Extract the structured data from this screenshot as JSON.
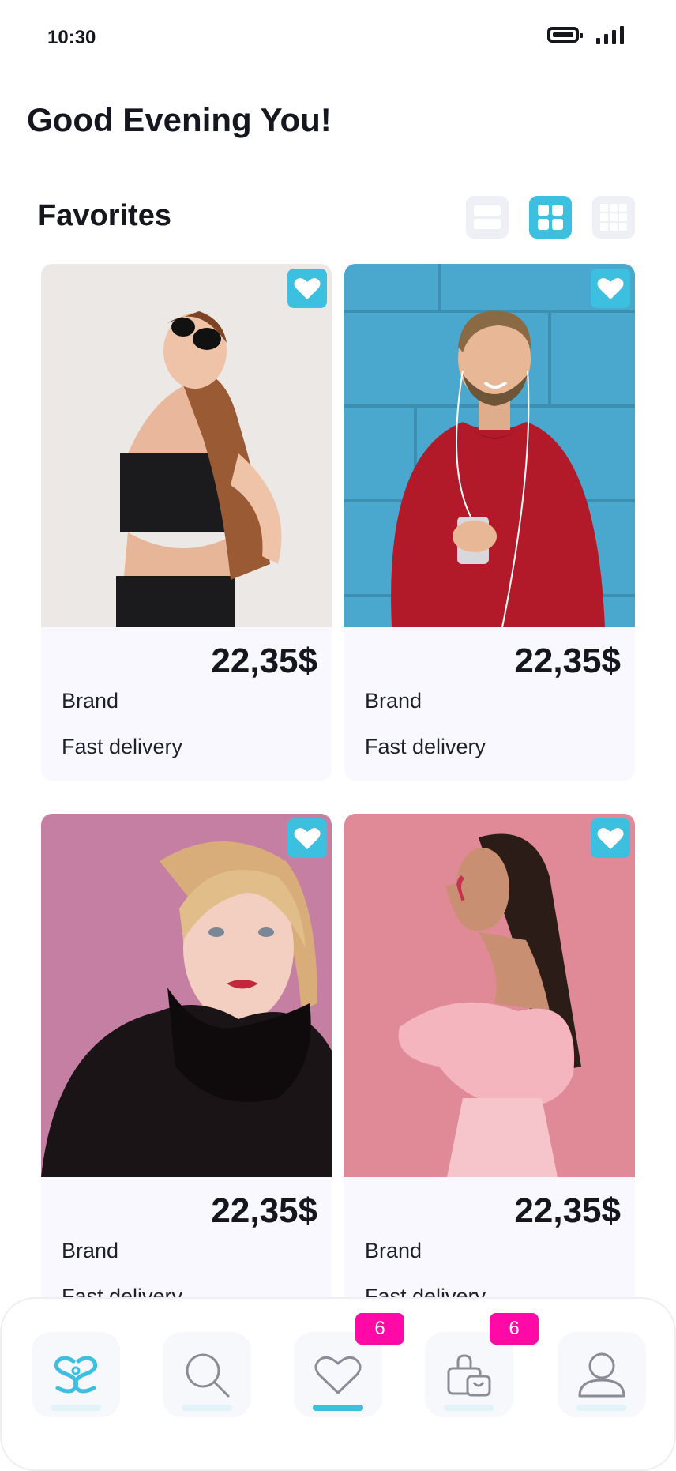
{
  "status_bar": {
    "time": "10:30"
  },
  "header": {
    "greeting": "Good Evening You!"
  },
  "section": {
    "title": "Favorites"
  },
  "products": [
    {
      "price": "22,35$",
      "brand": "Brand",
      "delivery": "Fast delivery",
      "image": "woman-sunglasses-black-top"
    },
    {
      "price": "22,35$",
      "brand": "Brand",
      "delivery": "Fast delivery",
      "image": "man-red-sweater-phone"
    },
    {
      "price": "22,35$",
      "brand": "Brand",
      "delivery": "Fast delivery",
      "image": "woman-blonde-black-scarf"
    },
    {
      "price": "22,35$",
      "brand": "Brand",
      "delivery": "Fast delivery",
      "image": "woman-pink-dress-profile"
    }
  ],
  "bottom_nav": {
    "items": [
      "home-logo-icon",
      "search-icon",
      "heart-icon",
      "shopping-bag-icon",
      "profile-icon"
    ],
    "favorites_badge": "6",
    "cart_badge": "6"
  },
  "colors": {
    "accent": "#3dbfe0",
    "badge": "#ff0aa6",
    "card_bg": "#f9f8ff",
    "text": "#15161e"
  }
}
